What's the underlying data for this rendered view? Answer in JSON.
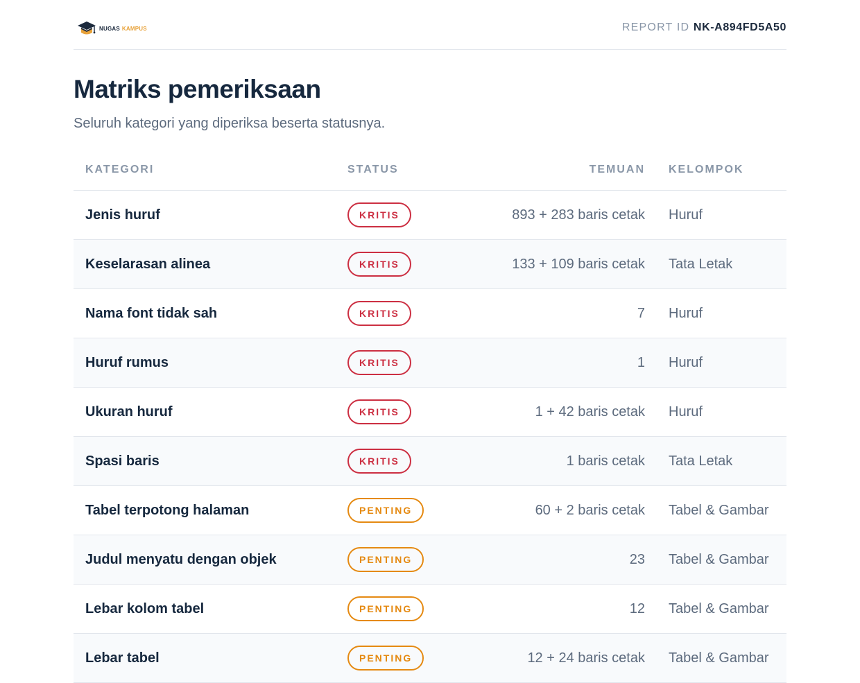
{
  "header": {
    "logo_name": "NUGAS",
    "logo_accent": "KAMPUS",
    "report_id_label": "REPORT ID",
    "report_id_value": "NK-A894FD5A50"
  },
  "title": "Matriks pemeriksaan",
  "subtitle": "Seluruh kategori yang diperiksa beserta statusnya.",
  "colors": {
    "kritis": "#cc2f42",
    "penting": "#e58a12",
    "logo_accent": "#e8a23a",
    "heading": "#16283e"
  },
  "table": {
    "columns": [
      "KATEGORI",
      "STATUS",
      "TEMUAN",
      "KELOMPOK"
    ],
    "rows": [
      {
        "kategori": "Jenis huruf",
        "status": "KRITIS",
        "temuan": "893 + 283 baris cetak",
        "kelompok": "Huruf"
      },
      {
        "kategori": "Keselarasan alinea",
        "status": "KRITIS",
        "temuan": "133 + 109 baris cetak",
        "kelompok": "Tata Letak"
      },
      {
        "kategori": "Nama font tidak sah",
        "status": "KRITIS",
        "temuan": "7",
        "kelompok": "Huruf"
      },
      {
        "kategori": "Huruf rumus",
        "status": "KRITIS",
        "temuan": "1",
        "kelompok": "Huruf"
      },
      {
        "kategori": "Ukuran huruf",
        "status": "KRITIS",
        "temuan": "1 + 42 baris cetak",
        "kelompok": "Huruf"
      },
      {
        "kategori": "Spasi baris",
        "status": "KRITIS",
        "temuan": "1 baris cetak",
        "kelompok": "Tata Letak"
      },
      {
        "kategori": "Tabel terpotong halaman",
        "status": "PENTING",
        "temuan": "60 + 2 baris cetak",
        "kelompok": "Tabel & Gambar"
      },
      {
        "kategori": "Judul menyatu dengan objek",
        "status": "PENTING",
        "temuan": "23",
        "kelompok": "Tabel & Gambar"
      },
      {
        "kategori": "Lebar kolom tabel",
        "status": "PENTING",
        "temuan": "12",
        "kelompok": "Tabel & Gambar"
      },
      {
        "kategori": "Lebar tabel",
        "status": "PENTING",
        "temuan": "12 + 24 baris cetak",
        "kelompok": "Tabel & Gambar"
      }
    ]
  }
}
